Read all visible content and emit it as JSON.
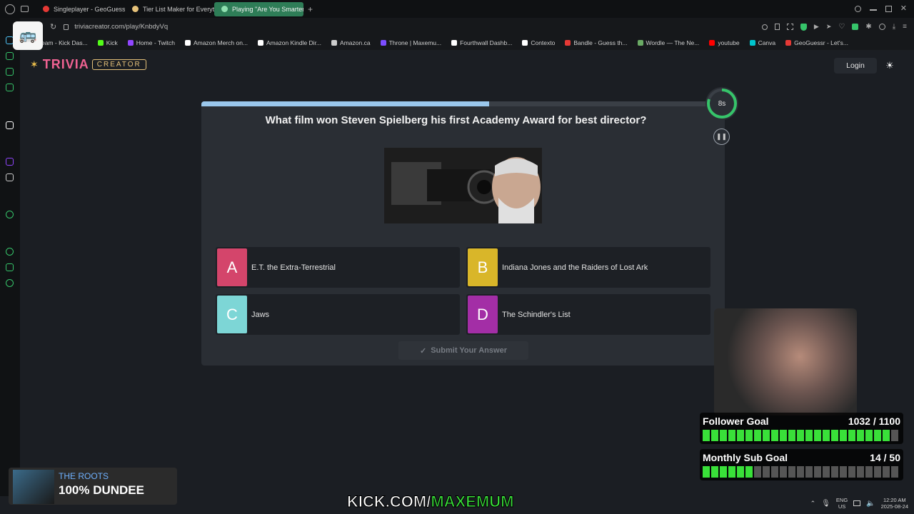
{
  "browser": {
    "tabs": [
      {
        "label": "Singleplayer - GeoGuessr",
        "color": "#e53935",
        "active": false
      },
      {
        "label": "Tier List Maker for Everyt",
        "color": "#e6c27a",
        "active": false
      },
      {
        "label": "Playing \"Are You Smarter",
        "color": "#2e7d57",
        "active": true
      }
    ],
    "new_tab": "+",
    "url": "triviacreator.com/play/KnbdyVq",
    "bookmarks": [
      {
        "label": "eam - Kick Das...",
        "color": "#53fc18"
      },
      {
        "label": "Kick",
        "color": "#53fc18"
      },
      {
        "label": "Home - Twitch",
        "color": "#9146ff"
      },
      {
        "label": "Amazon Merch on...",
        "color": "#ffffff"
      },
      {
        "label": "Amazon Kindle Dir...",
        "color": "#ffffff"
      },
      {
        "label": "Amazon.ca",
        "color": "#cccccc"
      },
      {
        "label": "Throne | Maxemu...",
        "color": "#7c4dff"
      },
      {
        "label": "Fourthwall Dashb...",
        "color": "#ffffff"
      },
      {
        "label": "Contexto",
        "color": "#ffffff"
      },
      {
        "label": "Bandle - Guess th...",
        "color": "#e53935"
      },
      {
        "label": "Wordle — The Ne...",
        "color": "#6aaa64"
      },
      {
        "label": "youtube",
        "color": "#ff0000"
      },
      {
        "label": "Canva",
        "color": "#00c4cc"
      },
      {
        "label": "GeoGuessr - Let's...",
        "color": "#e53935"
      }
    ]
  },
  "site": {
    "logo_main": "TRIVIA",
    "logo_sub": "CREATOR",
    "login": "Login",
    "theme_icon": "☀"
  },
  "quiz": {
    "progress": 0.55,
    "timer": "8s",
    "timer_fraction": 0.8,
    "question": "What film won Steven Spielberg his first Academy Award for best director?",
    "answers": [
      {
        "letter": "A",
        "label": "E.T. the Extra-Terrestrial",
        "color": "#d4456b"
      },
      {
        "letter": "B",
        "label": "Indiana Jones and the Raiders of Lost Ark",
        "color": "#d9b629"
      },
      {
        "letter": "C",
        "label": "Jaws",
        "color": "#7dd6d6"
      },
      {
        "letter": "D",
        "label": "The Schindler's List",
        "color": "#a32ea6"
      }
    ],
    "submit": "Submit Your Answer",
    "submit_icon": "✓"
  },
  "overlay": {
    "follower_goal": {
      "title": "Follower Goal",
      "count": "1032 / 1100",
      "fraction": 0.938
    },
    "sub_goal": {
      "title": "Monthly Sub Goal",
      "count": "14 / 50",
      "fraction": 0.28
    },
    "now_playing": {
      "artist": "THE ROOTS",
      "song": "100% DUNDEE"
    },
    "banner_white": "KICK.COM/",
    "banner_green": "MAXEMUM"
  },
  "taskbar": {
    "lang1": "ENG",
    "lang2": "US",
    "time": "12:20 AM",
    "date": "2025-08-24"
  }
}
